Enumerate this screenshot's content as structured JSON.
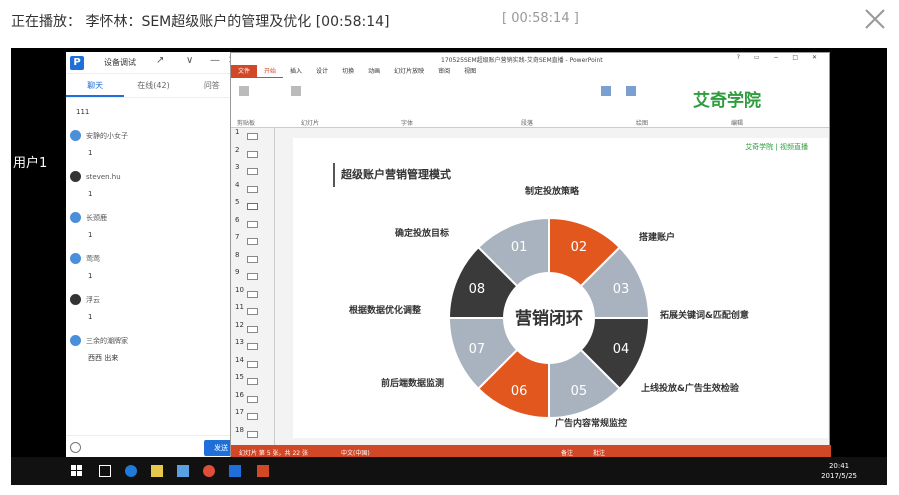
{
  "header": {
    "title": "正在播放： 李怀林：SEM超级账户的管理及优化 [00:58:14]",
    "time": "[ 00:58:14 ]"
  },
  "video": {
    "user_label": "用户1"
  },
  "chat": {
    "app_name": "设备调试",
    "tabs": [
      "聊天",
      "在线(42)",
      "问答"
    ],
    "messages": [
      {
        "name": "",
        "text": "111"
      },
      {
        "name": "安静的小女子",
        "text": "1"
      },
      {
        "name": "steven.hu",
        "text": "1"
      },
      {
        "name": "长颈鹿",
        "text": "1"
      },
      {
        "name": "莺莺",
        "text": "1"
      },
      {
        "name": "浮云",
        "text": "1"
      },
      {
        "name": "三余的潮牌家",
        "text": "西西 出来"
      }
    ],
    "send_label": "发送"
  },
  "ppt": {
    "filename": "170525SEM超级账户营销实践-艾奇SEM直播 - PowerPoint",
    "menu": [
      "文件",
      "开始",
      "插入",
      "设计",
      "切换",
      "动画",
      "幻灯片放映",
      "审阅",
      "视图"
    ],
    "ribbon_groups": [
      "剪贴板",
      "幻灯片",
      "字体",
      "段落",
      "绘图",
      "编辑"
    ],
    "brand": "艾奇学院",
    "slide_numbers": [
      "1",
      "2",
      "3",
      "4",
      "5",
      "6",
      "7",
      "8",
      "9",
      "10",
      "11",
      "12",
      "13",
      "14",
      "15",
      "16",
      "17",
      "18"
    ],
    "status_left": "幻灯片 第 5 张，共 22 张",
    "status_lang": "中文(中国)",
    "status_notes": "备注",
    "status_comments": "批注"
  },
  "slide": {
    "title": "超级账户营销管理模式",
    "center": "营销闭环",
    "logo": "艾奇学院 | 视频直播",
    "steps": [
      {
        "num": "01",
        "label": "确定投放目标"
      },
      {
        "num": "02",
        "label": "制定投放策略"
      },
      {
        "num": "03",
        "label": "搭建账户"
      },
      {
        "num": "04",
        "label": "拓展关键词&匹配创意"
      },
      {
        "num": "05",
        "label": "上线投放&广告生效检验"
      },
      {
        "num": "06",
        "label": "广告内容常规监控"
      },
      {
        "num": "07",
        "label": "前后端数据监测"
      },
      {
        "num": "08",
        "label": "根据数据优化调整"
      }
    ],
    "colors": {
      "orange": "#e2571e",
      "dark": "#3a3a3a",
      "gray": "#a9b3bf"
    }
  },
  "taskbar": {
    "time": "20:41",
    "date": "2017/5/25"
  }
}
